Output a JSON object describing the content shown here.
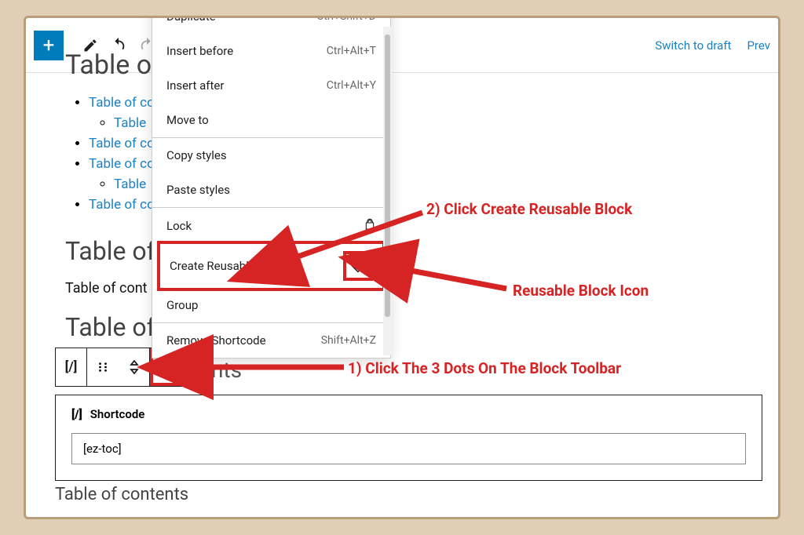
{
  "topbar": {
    "switch_draft": "Switch to draft",
    "preview": "Prev"
  },
  "page": {
    "heading_cut": "Table of c",
    "toc_items": [
      {
        "label": "Table of co",
        "children": [
          {
            "label": "Table"
          }
        ]
      },
      {
        "label": "Table of co"
      },
      {
        "label": "Table of co",
        "children": [
          {
            "label": "Table"
          }
        ]
      },
      {
        "label": "Table of co"
      }
    ],
    "heading2": "Table of c",
    "body1": "Table of cont",
    "heading3": "Table of c",
    "partial": "nts",
    "bottom": "Table of contents"
  },
  "dropdown": {
    "items": [
      {
        "label": "Duplicate",
        "shortcut": "Ctrl+Shift+D"
      },
      {
        "label": "Insert before",
        "shortcut": "Ctrl+Alt+T"
      },
      {
        "label": "Insert after",
        "shortcut": "Ctrl+Alt+Y"
      },
      {
        "label": "Move to",
        "shortcut": ""
      }
    ],
    "styles": [
      {
        "label": "Copy styles"
      },
      {
        "label": "Paste styles"
      }
    ],
    "lock": "Lock",
    "create_reusable": "Create Reusable block",
    "group": "Group",
    "remove": "Remove Shortcode",
    "remove_shortcut": "Shift+Alt+Z"
  },
  "shortcode": {
    "title": "Shortcode",
    "value": "[ez-toc]"
  },
  "annotations": {
    "step1": "1) Click The 3 Dots On The Block Toolbar",
    "step2": "2) Click Create Reusable Block",
    "icon_label": "Reusable Block Icon"
  }
}
